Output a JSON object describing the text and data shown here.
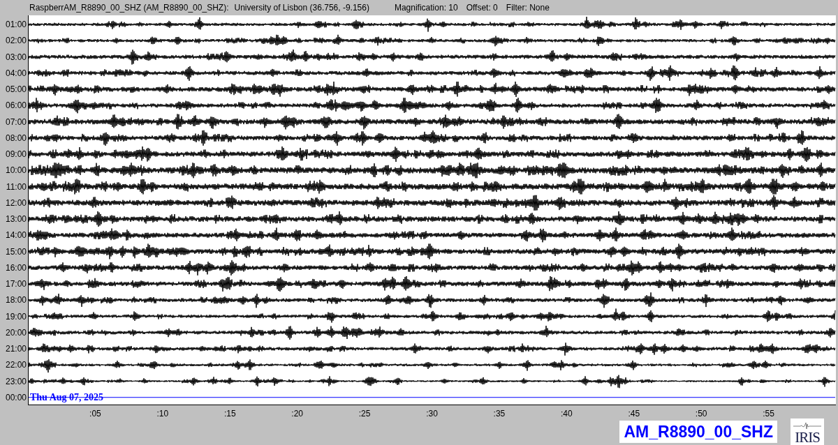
{
  "header": {
    "station": "RaspberrAM_R8890_00_SHZ (AM_R8890_00_SHZ):",
    "location": "University of Lisbon (36.756, -9.156)",
    "magnification": "Magnification: 10",
    "offset": "Offset: 0",
    "filter": "Filter: None"
  },
  "helicorder": {
    "rows": [
      {
        "time": "01:00",
        "kind": "trace"
      },
      {
        "time": "02:00",
        "kind": "trace"
      },
      {
        "time": "03:00",
        "kind": "trace"
      },
      {
        "time": "04:00",
        "kind": "trace"
      },
      {
        "time": "05:00",
        "kind": "trace"
      },
      {
        "time": "06:00",
        "kind": "trace"
      },
      {
        "time": "07:00",
        "kind": "trace"
      },
      {
        "time": "08:00",
        "kind": "trace"
      },
      {
        "time": "09:00",
        "kind": "trace"
      },
      {
        "time": "10:00",
        "kind": "trace"
      },
      {
        "time": "11:00",
        "kind": "trace"
      },
      {
        "time": "12:00",
        "kind": "trace"
      },
      {
        "time": "13:00",
        "kind": "trace"
      },
      {
        "time": "14:00",
        "kind": "trace"
      },
      {
        "time": "15:00",
        "kind": "trace"
      },
      {
        "time": "16:00",
        "kind": "trace"
      },
      {
        "time": "17:00",
        "kind": "trace"
      },
      {
        "time": "18:00",
        "kind": "trace"
      },
      {
        "time": "19:00",
        "kind": "trace"
      },
      {
        "time": "20:00",
        "kind": "trace"
      },
      {
        "time": "21:00",
        "kind": "trace"
      },
      {
        "time": "22:00",
        "kind": "trace"
      },
      {
        "time": "23:00",
        "kind": "trace"
      },
      {
        "time": "00:00",
        "kind": "current"
      }
    ],
    "date_label": "Thu Aug 07, 2025",
    "x_labels": [
      ":05",
      ":10",
      ":15",
      ":20",
      ":25",
      ":30",
      ":35",
      ":40",
      ":45",
      ":50",
      ":55"
    ]
  },
  "station_badge": "AM_R8890_00_SHZ",
  "logo": "IRIS"
}
